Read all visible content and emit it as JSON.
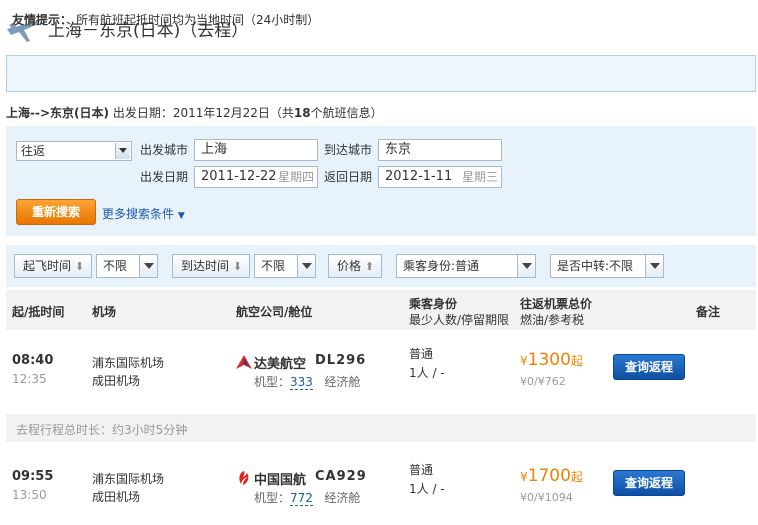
{
  "title": "上海－东京(日本)（去程）",
  "tip": {
    "label": "友情提示：",
    "text": "所有航班起抵时间均为当地时间（24小时制）"
  },
  "route_summary": {
    "route": "上海-->东京(日本)",
    "date_label": "出发日期：2011年12月22日（共",
    "count": "18",
    "suffix": "个航班信息）"
  },
  "search": {
    "trip_type": "往返",
    "from_label": "出发城市",
    "from_value": "上海",
    "to_label": "到达城市",
    "to_value": "东京",
    "depart_label": "出发日期",
    "depart_value": "2011-12-22",
    "depart_weekday": "星期四",
    "return_label": "返回日期",
    "return_value": "2012-1-11",
    "return_weekday": "星期三",
    "search_button": "重新搜索",
    "more_options": "更多搜索条件"
  },
  "filters": {
    "depart_time": "起飞时间",
    "depart_limit": "不限",
    "arrive_time": "到达时间",
    "arrive_limit": "不限",
    "price": "价格",
    "passenger": "乘客身份:普通",
    "transfer": "是否中转:不限"
  },
  "columns": {
    "time": "起/抵时间",
    "airport": "机场",
    "airline": "航空公司/舱位",
    "passenger": "乘客身份",
    "passenger_sub": "最少人数/停留期限",
    "price": "往返机票总价",
    "price_sub": "燃油/参考税",
    "remark": "备注"
  },
  "duration_note": "去程行程总时长：约3小时5分钟",
  "flights": [
    {
      "dep_time": "08:40",
      "arr_time": "12:35",
      "dep_airport": "浦东国际机场",
      "arr_airport": "成田机场",
      "airline": "达美航空",
      "flight_no": "DL296",
      "model_label": "机型：",
      "model": "333",
      "cabin": "经济舱",
      "pax_type": "普通",
      "pax_rule": "1人 / -",
      "price": "1300",
      "price_suffix": "起",
      "tax": "¥0/¥762",
      "button": "查询返程",
      "logo_color": "#d42c2c"
    },
    {
      "dep_time": "09:55",
      "arr_time": "13:50",
      "dep_airport": "浦东国际机场",
      "arr_airport": "成田机场",
      "airline": "中国国航",
      "flight_no": "CA929",
      "model_label": "机型：",
      "model": "772",
      "cabin": "经济舱",
      "pax_type": "普通",
      "pax_rule": "1人 / -",
      "price": "1700",
      "price_suffix": "起",
      "tax": "¥0/¥1094",
      "button": "查询返程",
      "logo_color": "#e0231b"
    }
  ],
  "currency": "¥",
  "colors": {
    "accent_orange": "#f08200",
    "link_blue": "#1d5aa8",
    "panel_blue": "#e7f2fb"
  }
}
